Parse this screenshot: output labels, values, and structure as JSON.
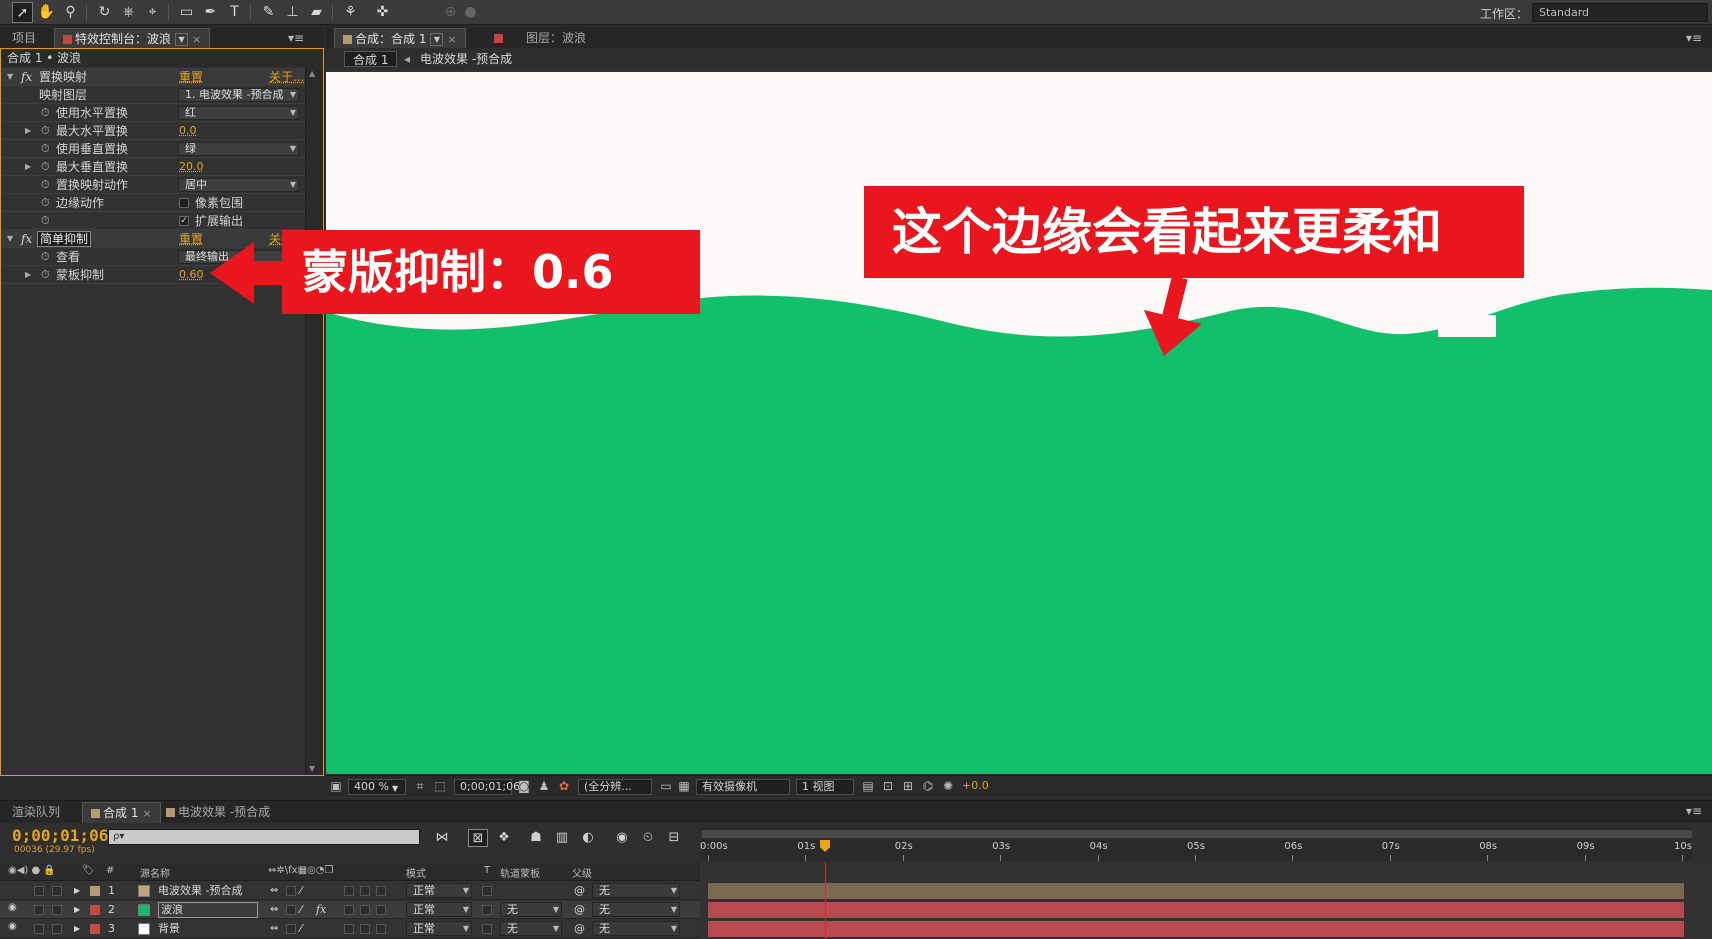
{
  "toolbar": {
    "tools": [
      "select-tool",
      "hand-tool",
      "zoom-tool",
      "rotate-tool",
      "orbit-camera-tool",
      "pan-behind-tool",
      "rectangle-tool",
      "pen-tool",
      "type-tool",
      "brush-tool",
      "clone-stamp-tool",
      "eraser-tool",
      "roto-brush-tool",
      "puppet-pin-tool"
    ],
    "workspace_label": "工作区：",
    "workspace_value": "Standard"
  },
  "left_tabs": {
    "project": "项目",
    "effect_controls": "特效控制台：波浪"
  },
  "fx": {
    "header": "合成 1 • 波浪",
    "displacement": {
      "name": "置换映射",
      "reset": "重置",
      "about": "关于...",
      "map_layer_label": "映射图层",
      "map_layer_value": "1. 电波效果 -预合成",
      "use_h_label": "使用水平置换",
      "use_h_value": "红",
      "max_h_label": "最大水平置换",
      "max_h_value": "0.0",
      "use_v_label": "使用垂直置换",
      "use_v_value": "绿",
      "max_v_label": "最大垂直置换",
      "max_v_value": "20.0",
      "behavior_label": "置换映射动作",
      "behavior_value": "居中",
      "edge_label": "边缘动作",
      "wrap_label": "像素包围",
      "expand_label": "扩展输出"
    },
    "choker": {
      "name": "简单抑制",
      "reset": "重置",
      "about": "关于...",
      "view_label": "查看",
      "view_value": "最终输出",
      "choke_label": "蒙板抑制",
      "choke_value": "0.60"
    }
  },
  "comp_tabs": {
    "composition": "合成：合成 1",
    "layer": "图层：波浪"
  },
  "breadcrumb": {
    "current": "合成 1",
    "child": "电波效果 -预合成"
  },
  "annotations": {
    "choke": "蒙版抑制：0.6",
    "edge": "这个边缘会看起来更柔和"
  },
  "viewer_status": {
    "zoom": "400 %",
    "timecode": "0;00;01;06",
    "resolution": "(全分辨...",
    "camera": "有效摄像机",
    "views": "1 视图",
    "exposure": "+0.0"
  },
  "timeline_tabs": {
    "render_queue": "渲染队列",
    "comp": "合成 1",
    "precomp": "电波效果 -预合成"
  },
  "timeline": {
    "timecode": "0;00;01;06",
    "fps": "00036 (29.97 fps)",
    "search_placeholder": "ρ▾",
    "col_num": "#",
    "col_source": "源名称",
    "col_mode": "模式",
    "col_t": "T",
    "col_track": "轨道蒙板",
    "col_parent": "父级",
    "ticks": [
      "0:00s",
      "01s",
      "02s",
      "03s",
      "04s",
      "05s",
      "06s",
      "07s",
      "08s",
      "09s",
      "10s"
    ],
    "layers": [
      {
        "num": "1",
        "name": "电波效果 -预合成",
        "mode": "正常",
        "track": "",
        "parent": "无",
        "color": "#b59a75",
        "swatch": "#c2a57f",
        "bar": "#7a6a52"
      },
      {
        "num": "2",
        "name": "波浪",
        "mode": "正常",
        "track": "无",
        "parent": "无",
        "color": "#c44a4a",
        "swatch": "#12c06c",
        "bar": "#b94a4f"
      },
      {
        "num": "3",
        "name": "背景",
        "mode": "正常",
        "track": "无",
        "parent": "无",
        "color": "#c44a4a",
        "swatch": "#ffffff",
        "bar": "#b94a4f"
      }
    ]
  },
  "colors": {
    "wave_green": "#12c06c",
    "sky_white": "#fdf9f8",
    "callout_red": "#e9171d",
    "accent_orange": "#e8a317"
  }
}
